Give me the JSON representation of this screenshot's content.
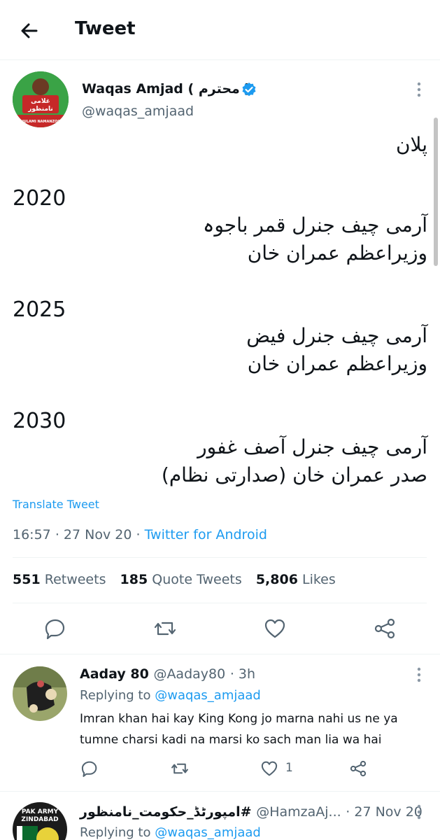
{
  "header": {
    "title": "Tweet"
  },
  "tweet": {
    "author_name": "Waqas Amjad",
    "author_honorific": "( محترم )",
    "author_handle": "@waqas_amjaad",
    "avatar_text_line1": "غلامی",
    "avatar_text_line2": "نامنظور",
    "avatar_text_line3": "GHULAMI NAMANZOOR",
    "lines": {
      "plan": "پلان",
      "year1": "2020",
      "y1_l1": "آرمی چیف جنرل قمر باجوہ",
      "y1_l2": "وزیراعظم عمران خان",
      "year2": "2025",
      "y2_l1": "آرمی چیف جنرل فیض",
      "y2_l2": "وزیراعظم عمران خان",
      "year3": "2030",
      "y3_l1": "آرمی چیف جنرل آصف غفور",
      "y3_l2": "صدر عمران خان (صدارتی نظام)"
    },
    "translate_label": "Translate Tweet",
    "time": "16:57",
    "date": "27 Nov 20",
    "source": "Twitter for Android",
    "separator": "·",
    "stats": {
      "retweets_count": "551",
      "retweets_label": "Retweets",
      "quotes_count": "185",
      "quotes_label": "Quote Tweets",
      "likes_count": "5,806",
      "likes_label": "Likes"
    },
    "icons": {
      "reply": "reply-icon",
      "retweet": "retweet-icon",
      "like": "heart-icon",
      "share": "share-icon"
    }
  },
  "replies": [
    {
      "name": "Aaday 80",
      "handle": "@Aaday80",
      "time": "· 3h",
      "replying_prefix": "Replying to",
      "replying_to": "@waqas_amjaad",
      "text": "Imran khan hai kay King Kong jo marna nahi us ne ya tumne charsi kadi na marsi ko sach man lia wa hai",
      "likes": "1"
    },
    {
      "name": "امپورٹڈ_حکومت_نامنظور#",
      "handle": "@HamzaAj...",
      "time": "· 27 Nov 20",
      "replying_prefix": "Replying to",
      "replying_to": "@waqas_amjaad",
      "avatar_text_line1": "PAK ARMY",
      "avatar_text_line2": "ZINDABAD"
    }
  ],
  "colors": {
    "accent": "#1d9bf0",
    "secondary_text": "#536471",
    "primary_text": "#0f1419",
    "divider": "#eff3f4"
  }
}
